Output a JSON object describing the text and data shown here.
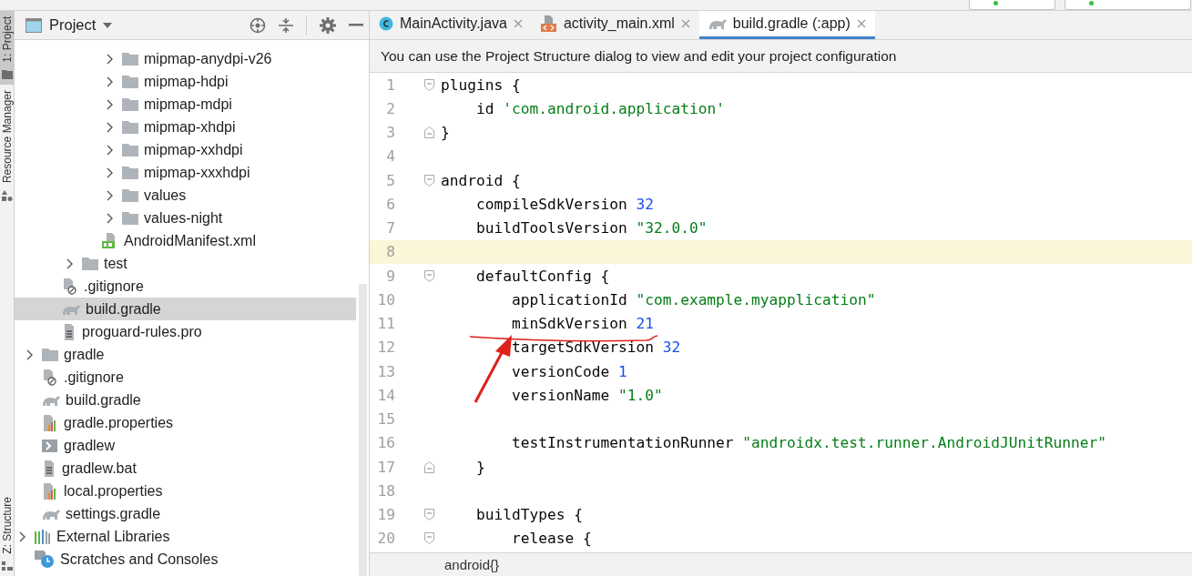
{
  "tool_strip": [
    {
      "label": "1: Project",
      "selected": true,
      "kind": "folder"
    },
    {
      "label": "Resource Manager",
      "selected": false,
      "kind": "shapes"
    },
    {
      "label": "Z: Structure",
      "selected": false,
      "kind": "structure"
    }
  ],
  "project_panel": {
    "title": "Project",
    "tree": [
      {
        "children": [
          {
            "children": [
              {
                "children": [
                  {
                    "children": [
                      {
                        "children": [
                          {
                            "label": "mipmap-anydpi-v26",
                            "kind": "folder",
                            "expanded": false,
                            "selected": false
                          },
                          {
                            "label": "mipmap-hdpi",
                            "kind": "folder",
                            "expanded": false,
                            "selected": false
                          },
                          {
                            "label": "mipmap-mdpi",
                            "kind": "folder",
                            "expanded": false,
                            "selected": false
                          },
                          {
                            "label": "mipmap-xhdpi",
                            "kind": "folder",
                            "expanded": false,
                            "selected": false
                          },
                          {
                            "label": "mipmap-xxhdpi",
                            "kind": "folder",
                            "expanded": false,
                            "selected": false
                          },
                          {
                            "label": "mipmap-xxxhdpi",
                            "kind": "folder",
                            "expanded": false,
                            "selected": false
                          },
                          {
                            "label": "values",
                            "kind": "folder",
                            "expanded": false,
                            "selected": false
                          },
                          {
                            "label": "values-night",
                            "kind": "folder",
                            "expanded": false,
                            "selected": false
                          }
                        ]
                      },
                      {
                        "label": "AndroidManifest.xml",
                        "kind": "manifest",
                        "selected": false
                      }
                    ]
                  },
                  {
                    "label": "test",
                    "kind": "folder",
                    "expanded": false,
                    "selected": false
                  }
                ]
              },
              {
                "label": ".gitignore",
                "kind": "ignore",
                "selected": false
              },
              {
                "label": "build.gradle",
                "kind": "gradle",
                "selected": true
              },
              {
                "label": "proguard-rules.pro",
                "kind": "text",
                "selected": false
              }
            ]
          },
          {
            "label": "gradle",
            "kind": "folder",
            "expanded": false,
            "selected": false
          },
          {
            "label": ".gitignore",
            "kind": "ignore",
            "selected": false
          },
          {
            "label": "build.gradle",
            "kind": "gradle",
            "selected": false
          },
          {
            "label": "gradle.properties",
            "kind": "properties",
            "selected": false
          },
          {
            "label": "gradlew",
            "kind": "shell",
            "selected": false
          },
          {
            "label": "gradlew.bat",
            "kind": "text",
            "selected": false
          },
          {
            "label": "local.properties",
            "kind": "properties",
            "selected": false
          },
          {
            "label": "settings.gradle",
            "kind": "gradle",
            "selected": false
          }
        ]
      },
      {
        "label": "External Libraries",
        "kind": "libraries",
        "expanded": false,
        "selected": false
      },
      {
        "label": "Scratches and Consoles",
        "kind": "scratches",
        "selected": false
      }
    ]
  },
  "tabs": [
    {
      "label": "MainActivity.java",
      "kind": "class",
      "selected": false
    },
    {
      "label": "activity_main.xml",
      "kind": "xml",
      "selected": false
    },
    {
      "label": "build.gradle (:app)",
      "kind": "gradle",
      "selected": true
    }
  ],
  "banner": "You can use the Project Structure dialog to view and edit your project configuration",
  "code_lines": [
    {
      "number": "1",
      "kind": "fold_start",
      "selected": false,
      "tokens": [
        {
          "kind": "plain",
          "text": "plugins {"
        }
      ]
    },
    {
      "number": "2",
      "kind": "plain",
      "selected": false,
      "tokens": [
        {
          "kind": "plain",
          "text": "    id "
        },
        {
          "kind": "string",
          "text": "'com.android.application'"
        }
      ]
    },
    {
      "number": "3",
      "kind": "fold_end",
      "selected": false,
      "tokens": [
        {
          "kind": "plain",
          "text": "}"
        }
      ]
    },
    {
      "number": "4",
      "kind": "plain",
      "selected": false
    },
    {
      "number": "5",
      "kind": "fold_start",
      "selected": false,
      "tokens": [
        {
          "kind": "plain",
          "text": "android {"
        }
      ]
    },
    {
      "number": "6",
      "kind": "plain",
      "selected": false,
      "tokens": [
        {
          "kind": "plain",
          "text": "    compileSdkVersion "
        },
        {
          "kind": "number",
          "text": "32"
        }
      ]
    },
    {
      "number": "7",
      "kind": "plain",
      "selected": false,
      "tokens": [
        {
          "kind": "plain",
          "text": "    buildToolsVersion "
        },
        {
          "kind": "string",
          "text": "\"32.0.0\""
        }
      ]
    },
    {
      "number": "8",
      "kind": "plain",
      "selected": true
    },
    {
      "number": "9",
      "kind": "fold_start",
      "selected": false,
      "tokens": [
        {
          "kind": "plain",
          "text": "    defaultConfig {"
        }
      ]
    },
    {
      "number": "10",
      "kind": "plain",
      "selected": false,
      "tokens": [
        {
          "kind": "plain",
          "text": "        applicationId "
        },
        {
          "kind": "string",
          "text": "\"com.example.myapplication\""
        }
      ]
    },
    {
      "number": "11",
      "kind": "plain",
      "selected": false,
      "tokens": [
        {
          "kind": "plain",
          "text": "        minSdkVersion "
        },
        {
          "kind": "number",
          "text": "21"
        }
      ]
    },
    {
      "number": "12",
      "kind": "plain",
      "selected": false,
      "tokens": [
        {
          "kind": "plain",
          "text": "        targetSdkVersion "
        },
        {
          "kind": "number",
          "text": "32"
        }
      ]
    },
    {
      "number": "13",
      "kind": "plain",
      "selected": false,
      "tokens": [
        {
          "kind": "plain",
          "text": "        versionCode "
        },
        {
          "kind": "number",
          "text": "1"
        }
      ]
    },
    {
      "number": "14",
      "kind": "plain",
      "selected": false,
      "tokens": [
        {
          "kind": "plain",
          "text": "        versionName "
        },
        {
          "kind": "string",
          "text": "\"1.0\""
        }
      ]
    },
    {
      "number": "15",
      "kind": "plain",
      "selected": false
    },
    {
      "number": "16",
      "kind": "plain",
      "selected": false,
      "tokens": [
        {
          "kind": "plain",
          "text": "        testInstrumentationRunner "
        },
        {
          "kind": "string",
          "text": "\"androidx.test.runner.AndroidJUnitRunner\""
        }
      ]
    },
    {
      "number": "17",
      "kind": "fold_end",
      "selected": false,
      "tokens": [
        {
          "kind": "plain",
          "text": "    }"
        }
      ]
    },
    {
      "number": "18",
      "kind": "plain",
      "selected": false
    },
    {
      "number": "19",
      "kind": "fold_start",
      "selected": false,
      "tokens": [
        {
          "kind": "plain",
          "text": "    buildTypes {"
        }
      ]
    },
    {
      "number": "20",
      "kind": "fold_start",
      "selected": false,
      "tokens": [
        {
          "kind": "plain",
          "text": "        release {"
        }
      ]
    }
  ],
  "breadcrumb": "android{}"
}
